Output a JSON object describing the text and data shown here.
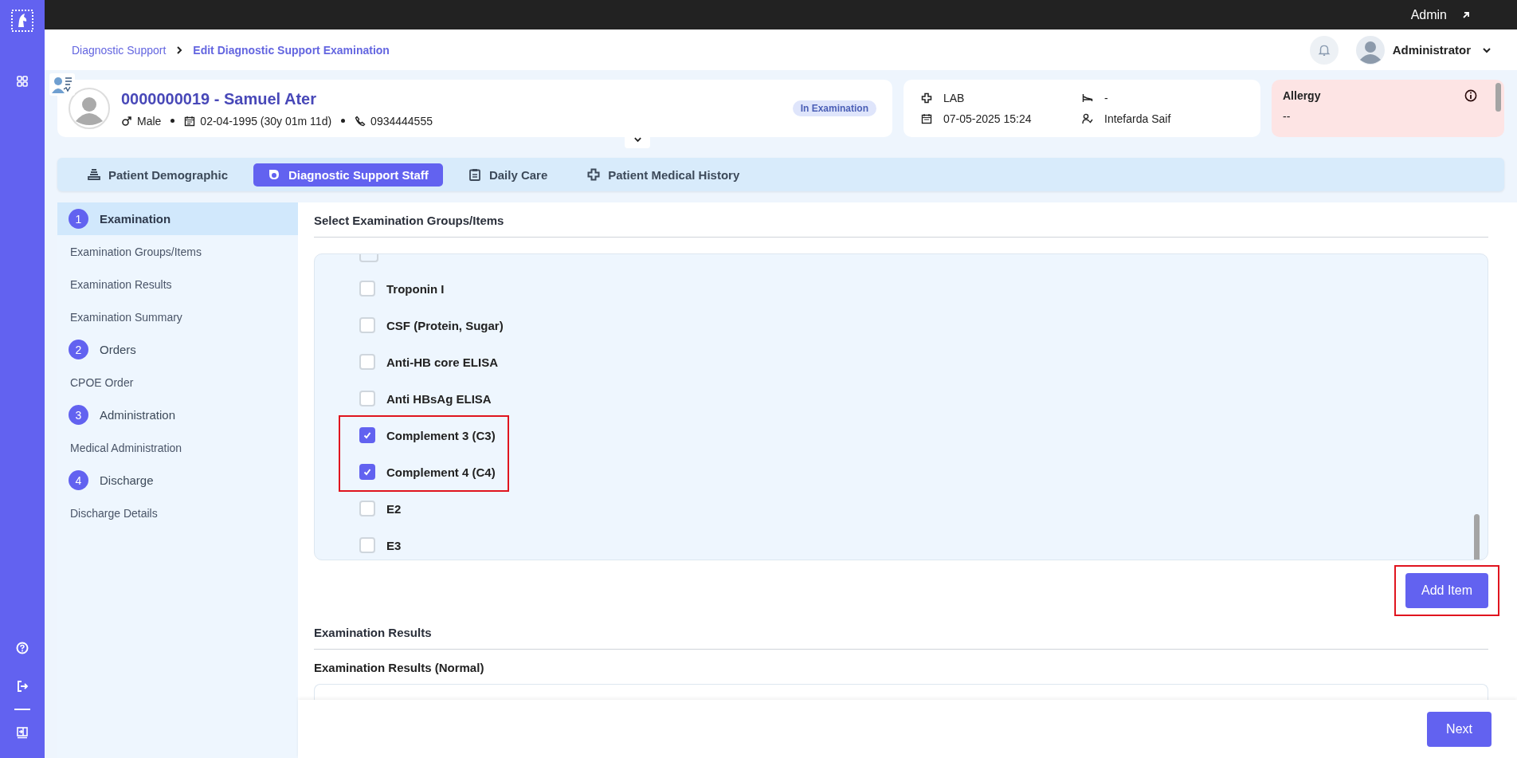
{
  "topbar": {
    "user": "Admin"
  },
  "breadcrumb": [
    {
      "label": "Diagnostic Support",
      "current": false
    },
    {
      "label": "Edit Diagnostic Support Examination",
      "current": true
    }
  ],
  "account": {
    "name": "Administrator"
  },
  "patient": {
    "title": "0000000019 - Samuel Ater",
    "gender": "Male",
    "dob": "02-04-1995 (30y 01m 11d)",
    "phone": "0934444555",
    "status": "In Examination"
  },
  "visit": {
    "unit": "LAB",
    "date": "07-05-2025 15:24",
    "bed": "-",
    "doctor": "Intefarda Saif"
  },
  "allergy": {
    "title": "Allergy",
    "value": "--"
  },
  "tabs": [
    {
      "label": "Patient Demographic",
      "kind": "demographic",
      "selected": false
    },
    {
      "label": "Diagnostic Support Staff",
      "kind": "staff",
      "selected": true
    },
    {
      "label": "Daily Care",
      "kind": "care",
      "selected": false
    },
    {
      "label": "Patient Medical History",
      "kind": "history",
      "selected": false
    }
  ],
  "steps": [
    {
      "number": "1",
      "label": "Examination",
      "selected": true,
      "children": [
        {
          "label": "Examination Groups/Items"
        },
        {
          "label": "Examination Results"
        },
        {
          "label": "Examination Summary"
        }
      ]
    },
    {
      "number": "2",
      "label": "Orders",
      "selected": false,
      "children": [
        {
          "label": "CPOE Order"
        }
      ]
    },
    {
      "number": "3",
      "label": "Administration",
      "selected": false,
      "children": [
        {
          "label": "Medical Administration"
        }
      ]
    },
    {
      "number": "4",
      "label": "Discharge",
      "selected": false,
      "children": [
        {
          "label": "Discharge Details"
        }
      ]
    }
  ],
  "section": {
    "title": "Select Examination Groups/Items"
  },
  "items": [
    {
      "label": "Troponin I",
      "checked": false,
      "highlighted": false
    },
    {
      "label": "CSF (Protein, Sugar)",
      "checked": false,
      "highlighted": false
    },
    {
      "label": "Anti-HB core ELISA",
      "checked": false,
      "highlighted": false
    },
    {
      "label": "Anti HBsAg ELISA",
      "checked": false,
      "highlighted": false
    },
    {
      "label": "Complement 3 (C3)",
      "checked": true,
      "highlighted": true
    },
    {
      "label": "Complement 4 (C4)",
      "checked": true,
      "highlighted": true
    },
    {
      "label": "E2",
      "checked": false,
      "highlighted": false
    },
    {
      "label": "E3",
      "checked": false,
      "highlighted": false
    }
  ],
  "add_button": {
    "label": "Add Item",
    "highlighted": true
  },
  "results": {
    "title": "Examination Results",
    "subtitle": "Examination Results (Normal)"
  },
  "footer": {
    "next": "Next"
  }
}
